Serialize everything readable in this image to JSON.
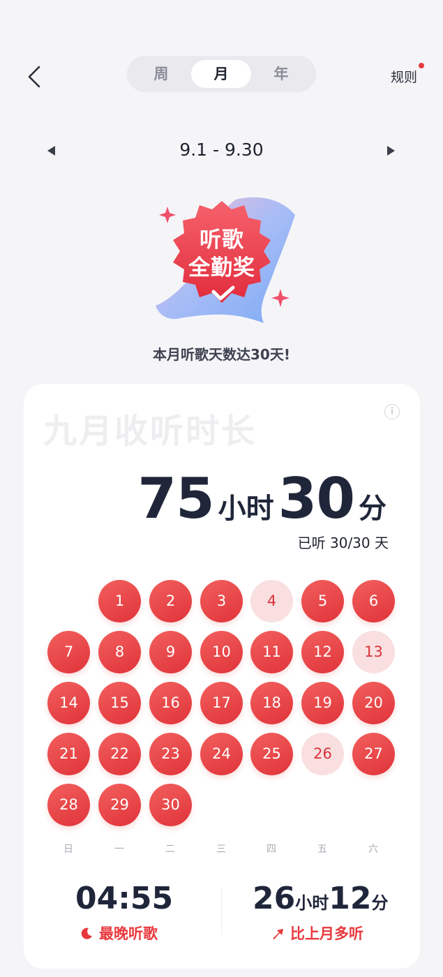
{
  "header": {
    "tabs": [
      {
        "label": "周",
        "active": false
      },
      {
        "label": "月",
        "active": true
      },
      {
        "label": "年",
        "active": false
      }
    ],
    "rules_label": "规则",
    "back_icon": "chevron-left-icon"
  },
  "period": {
    "range": "9.1 - 9.30",
    "prev_icon": "triangle-left-icon",
    "next_icon": "triangle-right-icon"
  },
  "award": {
    "badge_line1": "听歌",
    "badge_line2": "全勤奖",
    "description": "本月听歌天数达30天!"
  },
  "summary": {
    "title": "九月收听时长",
    "hours": "75",
    "hours_unit": "小时",
    "minutes": "30",
    "minutes_unit": "分",
    "days_listened": "已听 30/30 天"
  },
  "calendar": {
    "weekdays": [
      "日",
      "一",
      "二",
      "三",
      "四",
      "五",
      "六"
    ],
    "first_weekday_index": 1,
    "days": [
      {
        "day": "1",
        "style": "full"
      },
      {
        "day": "2",
        "style": "full"
      },
      {
        "day": "3",
        "style": "full"
      },
      {
        "day": "4",
        "style": "light"
      },
      {
        "day": "5",
        "style": "full"
      },
      {
        "day": "6",
        "style": "full"
      },
      {
        "day": "7",
        "style": "full"
      },
      {
        "day": "8",
        "style": "full"
      },
      {
        "day": "9",
        "style": "full"
      },
      {
        "day": "10",
        "style": "full"
      },
      {
        "day": "11",
        "style": "full"
      },
      {
        "day": "12",
        "style": "full"
      },
      {
        "day": "13",
        "style": "light"
      },
      {
        "day": "14",
        "style": "full"
      },
      {
        "day": "15",
        "style": "full"
      },
      {
        "day": "16",
        "style": "full"
      },
      {
        "day": "17",
        "style": "full"
      },
      {
        "day": "18",
        "style": "full"
      },
      {
        "day": "19",
        "style": "full"
      },
      {
        "day": "20",
        "style": "full"
      },
      {
        "day": "21",
        "style": "full"
      },
      {
        "day": "22",
        "style": "full"
      },
      {
        "day": "23",
        "style": "full"
      },
      {
        "day": "24",
        "style": "full"
      },
      {
        "day": "25",
        "style": "full"
      },
      {
        "day": "26",
        "style": "light"
      },
      {
        "day": "27",
        "style": "full"
      },
      {
        "day": "28",
        "style": "full"
      },
      {
        "day": "29",
        "style": "full"
      },
      {
        "day": "30",
        "style": "full"
      }
    ]
  },
  "stats": {
    "latest_time": "04:55",
    "latest_label": "最晚听歌",
    "latest_icon": "moon-icon",
    "more_hours": "26",
    "more_hours_unit": "小时",
    "more_minutes": "12",
    "more_minutes_unit": "分",
    "more_label": "比上月多听",
    "more_icon": "trend-up-arrow-icon"
  },
  "colors": {
    "accent": "#e8383d",
    "day_full": "#e7403f",
    "day_light": "#f9dfdf",
    "text_dark": "#20263a",
    "background": "#f5f5f8"
  }
}
